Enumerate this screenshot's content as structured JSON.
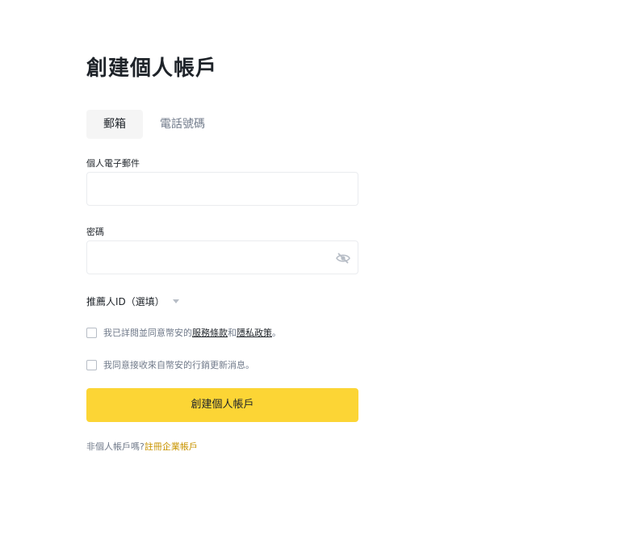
{
  "page": {
    "title": "創建個人帳戶"
  },
  "tabs": [
    {
      "label": "郵箱",
      "active": true
    },
    {
      "label": "電話號碼",
      "active": false
    }
  ],
  "email": {
    "label": "個人電子郵件",
    "value": "",
    "placeholder": ""
  },
  "password": {
    "label": "密碼",
    "value": "",
    "placeholder": "",
    "toggle_icon": "eye-off-icon"
  },
  "referral": {
    "label": "推薦人ID（選填）",
    "icon": "caret-down-icon"
  },
  "terms": {
    "prefix": "我已詳閱並同意幣安的",
    "service_link": "服務條款",
    "and": "和",
    "privacy_link": "隱私政策",
    "suffix": "。",
    "checked": false
  },
  "marketing": {
    "label": "我同意接收來自幣安的行銷更新消息。",
    "checked": false
  },
  "submit": {
    "label": "創建個人帳戶"
  },
  "footer": {
    "prefix": "非個人帳戶嗎?",
    "link": "註冊企業帳戶"
  },
  "colors": {
    "accent": "#fcd535",
    "link_yellow": "#c99400",
    "text": "#1e2329",
    "muted": "#707a8a",
    "border": "#eaecef"
  }
}
